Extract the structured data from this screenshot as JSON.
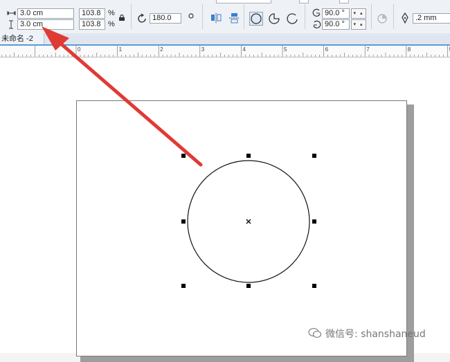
{
  "toolbar": {
    "width_value": "3.0 cm",
    "height_value": "3.0 cm",
    "scale_x": "103.8",
    "scale_y": "103.8",
    "percent_x": "%",
    "percent_y": "%",
    "rotation_value": "180.0",
    "start_angle": "90.0 °",
    "end_angle": "90.0 °",
    "outline_width": ".2 mm",
    "spin_glyphs": "▾ ▴"
  },
  "document_tab": {
    "label": "未命名 -2"
  },
  "ruler": {
    "labels": [
      "0",
      "1",
      "2",
      "3",
      "4",
      "5",
      "6",
      "7",
      "8",
      "9"
    ]
  },
  "watermark": {
    "text": "微信号: shanshaneud"
  },
  "colors": {
    "arrow": "#e03a35",
    "accent": "#5b9bd5",
    "handle": "#000000"
  }
}
